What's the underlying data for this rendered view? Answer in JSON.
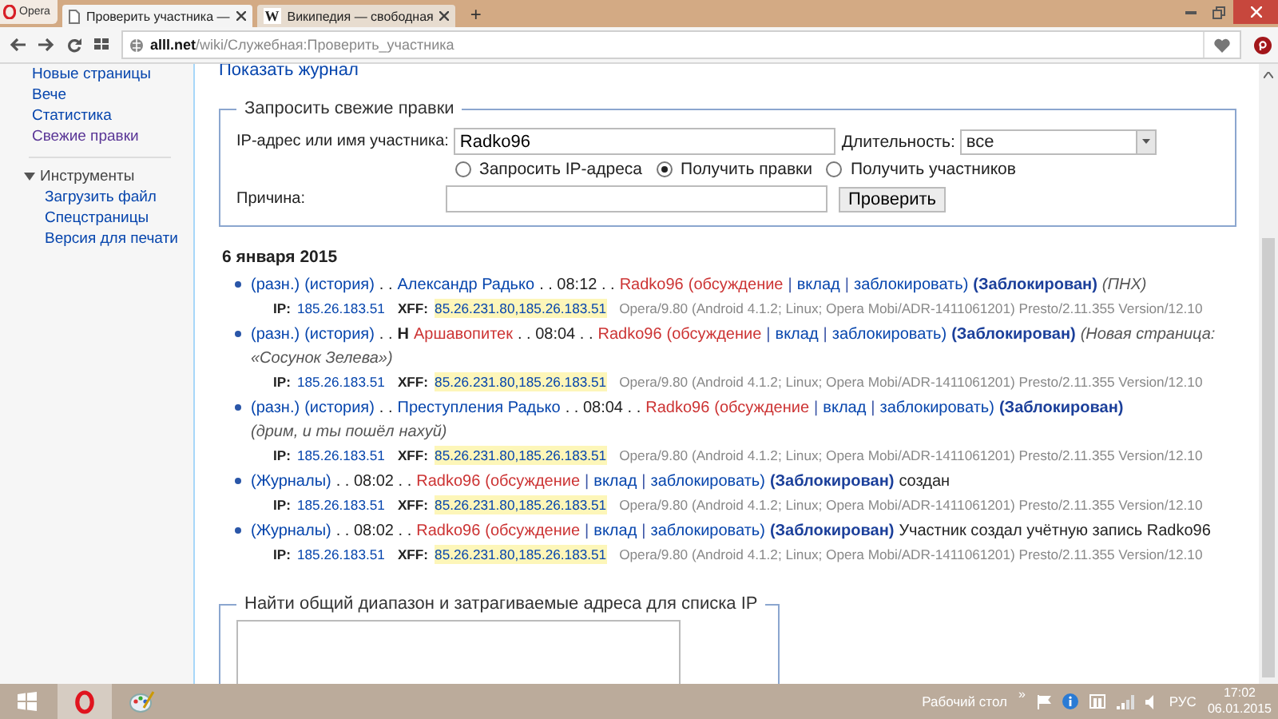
{
  "browser": {
    "menu_label": "Opera",
    "tabs": [
      {
        "title": "Проверить участника —",
        "selected": true
      },
      {
        "title": "Википедия — свободная",
        "icon_text": "W",
        "selected": false
      }
    ],
    "new_tab": "+",
    "address": {
      "domain": "alll.net",
      "path": "/wiki/Служебная:Проверить_участника"
    }
  },
  "sidebar": {
    "items": [
      {
        "label": "Новые страницы",
        "visited": false
      },
      {
        "label": "Вече",
        "visited": false
      },
      {
        "label": "Статистика",
        "visited": false
      },
      {
        "label": "Свежие правки",
        "visited": true
      }
    ],
    "tools": {
      "label": "Инструменты",
      "expanded": true,
      "children": [
        "Загрузить файл",
        "Спецстраницы",
        "Версия для печати"
      ]
    }
  },
  "main": {
    "top_link": "Показать журнал",
    "form": {
      "legend": "Запросить свежие правки",
      "target_label": "IP-адрес или имя участника:",
      "target_value": "Radko96",
      "duration_label": "Длительность:",
      "duration_value": "все",
      "radios": [
        {
          "label": "Запросить IP-адреса",
          "selected": false
        },
        {
          "label": "Получить правки",
          "selected": true
        },
        {
          "label": "Получить участников",
          "selected": false
        }
      ],
      "reason_label": "Причина:",
      "button": "Проверить"
    },
    "date": "6 января 2015",
    "entries": [
      {
        "segments": [
          {
            "kind": "link",
            "text": "(разн.)"
          },
          {
            "kind": "link",
            "text": "(история)"
          },
          {
            "kind": "plain",
            "text": ". ."
          },
          {
            "kind": "link",
            "text": "Александр Радько"
          },
          {
            "kind": "plain",
            "text": ". . 08:12 . ."
          },
          {
            "kind": "red",
            "text": "Radko96"
          },
          {
            "kind": "red",
            "text": "(обсуждение"
          },
          {
            "kind": "sep",
            "text": "|"
          },
          {
            "kind": "link",
            "text": "вклад"
          },
          {
            "kind": "sep",
            "text": "|"
          },
          {
            "kind": "link",
            "text": "заблокировать)"
          },
          {
            "kind": "blocked",
            "text": "(Заблокирован)"
          },
          {
            "kind": "comment",
            "text": "(ПНХ)"
          }
        ],
        "meta": {
          "ip_label": "IP:",
          "ip": "185.26.183.51",
          "xff_label": "XFF:",
          "xff": "85.26.231.80,185.26.183.51",
          "agent": "Opera/9.80 (Android 4.1.2; Linux; Opera Mobi/ADR-1411061201) Presto/2.11.355 Version/12.10"
        }
      },
      {
        "segments": [
          {
            "kind": "link",
            "text": "(разн.)"
          },
          {
            "kind": "link",
            "text": "(история)"
          },
          {
            "kind": "plain",
            "text": ". ."
          },
          {
            "kind": "flag",
            "text": "Н"
          },
          {
            "kind": "red",
            "text": "Аршавопитек"
          },
          {
            "kind": "plain",
            "text": ". . 08:04 . ."
          },
          {
            "kind": "red",
            "text": "Radko96"
          },
          {
            "kind": "red",
            "text": "(обсуждение"
          },
          {
            "kind": "sep",
            "text": "|"
          },
          {
            "kind": "link",
            "text": "вклад"
          },
          {
            "kind": "sep",
            "text": "|"
          },
          {
            "kind": "link",
            "text": "заблокировать)"
          },
          {
            "kind": "blocked",
            "text": "(Заблокирован)"
          },
          {
            "kind": "comment",
            "text": "(Новая страница:"
          },
          {
            "kind": "comment",
            "text": "«Сосунок Зелева»)"
          }
        ],
        "meta": {
          "ip_label": "IP:",
          "ip": "185.26.183.51",
          "xff_label": "XFF:",
          "xff": "85.26.231.80,185.26.183.51",
          "agent": "Opera/9.80 (Android 4.1.2; Linux; Opera Mobi/ADR-1411061201) Presto/2.11.355 Version/12.10"
        }
      },
      {
        "segments": [
          {
            "kind": "link",
            "text": "(разн.)"
          },
          {
            "kind": "link",
            "text": "(история)"
          },
          {
            "kind": "plain",
            "text": ". ."
          },
          {
            "kind": "link",
            "text": "Преступления Радько"
          },
          {
            "kind": "plain",
            "text": ". . 08:04 . ."
          },
          {
            "kind": "red",
            "text": "Radko96"
          },
          {
            "kind": "red",
            "text": "(обсуждение"
          },
          {
            "kind": "sep",
            "text": "|"
          },
          {
            "kind": "link",
            "text": "вклад"
          },
          {
            "kind": "sep",
            "text": "|"
          },
          {
            "kind": "link",
            "text": "заблокировать)"
          },
          {
            "kind": "blocked",
            "text": "(Заблокирован)"
          },
          {
            "kind": "comment",
            "text": "(дрим, и ты пошёл"
          },
          {
            "kind": "comment",
            "text": "нахуй)"
          }
        ],
        "meta": {
          "ip_label": "IP:",
          "ip": "185.26.183.51",
          "xff_label": "XFF:",
          "xff": "85.26.231.80,185.26.183.51",
          "agent": "Opera/9.80 (Android 4.1.2; Linux; Opera Mobi/ADR-1411061201) Presto/2.11.355 Version/12.10"
        }
      },
      {
        "segments": [
          {
            "kind": "link",
            "text": "(Журналы)"
          },
          {
            "kind": "plain",
            "text": ". . 08:02 . ."
          },
          {
            "kind": "red",
            "text": "Radko96"
          },
          {
            "kind": "red",
            "text": "(обсуждение"
          },
          {
            "kind": "sep",
            "text": "|"
          },
          {
            "kind": "link",
            "text": "вклад"
          },
          {
            "kind": "sep",
            "text": "|"
          },
          {
            "kind": "link",
            "text": "заблокировать)"
          },
          {
            "kind": "blocked",
            "text": "(Заблокирован)"
          },
          {
            "kind": "plain",
            "text": "создан"
          }
        ],
        "meta": {
          "ip_label": "IP:",
          "ip": "185.26.183.51",
          "xff_label": "XFF:",
          "xff": "85.26.231.80,185.26.183.51",
          "agent": "Opera/9.80 (Android 4.1.2; Linux; Opera Mobi/ADR-1411061201) Presto/2.11.355 Version/12.10"
        }
      },
      {
        "segments": [
          {
            "kind": "link",
            "text": "(Журналы)"
          },
          {
            "kind": "plain",
            "text": ". . 08:02 . ."
          },
          {
            "kind": "red",
            "text": "Radko96"
          },
          {
            "kind": "red",
            "text": "(обсуждение"
          },
          {
            "kind": "sep",
            "text": "|"
          },
          {
            "kind": "link",
            "text": "вклад"
          },
          {
            "kind": "sep",
            "text": "|"
          },
          {
            "kind": "link",
            "text": "заблокировать)"
          },
          {
            "kind": "blocked",
            "text": "(Заблокирован)"
          },
          {
            "kind": "plain",
            "text": "Участник создал учётную запись Radko96"
          }
        ],
        "meta": {
          "ip_label": "IP:",
          "ip": "185.26.183.51",
          "xff_label": "XFF:",
          "xff": "85.26.231.80,185.26.183.51",
          "agent": "Opera/9.80 (Android 4.1.2; Linux; Opera Mobi/ADR-1411061201) Presto/2.11.355 Version/12.10"
        }
      }
    ],
    "range_form": {
      "legend": "Найти общий диапазон и затрагиваемые адреса для списка IP"
    }
  },
  "taskbar": {
    "desktop_label": "Рабочий стол",
    "more": "»",
    "language": "РУС",
    "time": "17:02",
    "date": "06.01.2015"
  }
}
